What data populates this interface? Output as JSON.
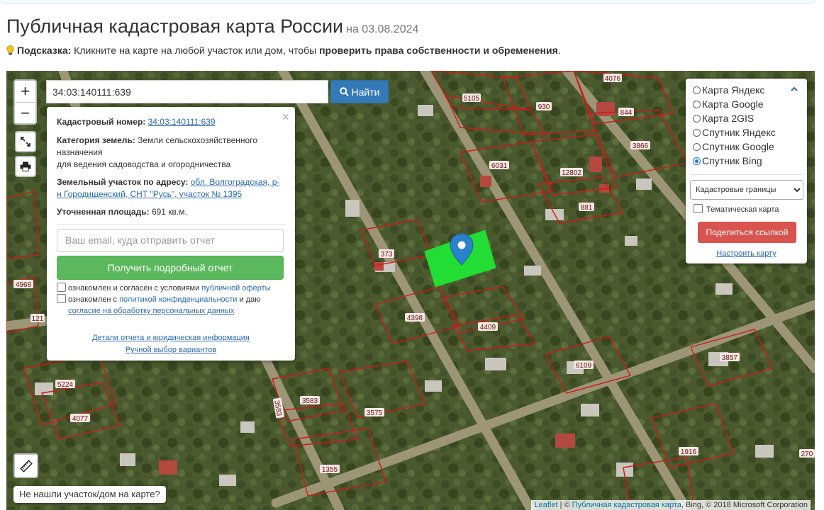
{
  "header": {
    "title": "Публичная кадастровая карта России",
    "date": "на 03.08.2024",
    "hint_label": "Подсказка:",
    "hint_text": " Кликните на карте на любой участок или дом, чтобы ",
    "hint_bold": "проверить права собственности и обременения",
    "hint_end": "."
  },
  "map": {
    "zoom_in": "+",
    "zoom_out": "−",
    "search_value": "34:03:140111:639",
    "search_button": "Найти",
    "parcel_numbers": [
      "4076",
      "5105",
      "930",
      "844",
      "3866",
      "6031",
      "12802",
      "881",
      "373",
      "4968",
      "121",
      "4398",
      "4409",
      "6109",
      "3857",
      "5224",
      "4077",
      "3583",
      "3575",
      "3583",
      "1916",
      "1355",
      "270"
    ],
    "selected_parcel_color": "#22dd33",
    "boundary_color": "#d01818",
    "not_found": "Не нашли участок/дом на карте?",
    "attribution": {
      "leaflet": "Leaflet",
      "sep": " | © ",
      "source": "Публичная кадастровая карта",
      "rest": ", Bing, © 2018 Microsoft Corporation"
    }
  },
  "popup": {
    "close": "×",
    "cad_label": "Кадастровый номер:",
    "cad_value": "34:03:140111:639",
    "cat_label": "Категория земель:",
    "cat_value_1": "Земли сельскохозяйственного",
    "cat_value_2": "назначения",
    "cat_value_3": "для ведения садоводства и огородничества",
    "addr_label": "Земельный участок по адресу:",
    "addr_value_1": "обл. Волгоградская, р-",
    "addr_value_2": "н Городищенский, СНТ \"Русь\", участок № 1395",
    "area_label": "Уточненная площадь:",
    "area_value": "691 кв.м.",
    "email_placeholder": "Ваш email, куда отправить отчет",
    "report_button": "Получить подробный отчет",
    "consent1_pre": "ознакомлен и согласен с условиями ",
    "consent1_link": "публичной оферты",
    "consent2_pre": "ознакомлен с ",
    "consent2_link": "политикой конфиденциальности",
    "consent2_mid": " и даю",
    "consent2_link2": "согласие на обработку персональных данных",
    "details_link": "Детали отчета и юридическая информация",
    "manual_link": "Ручной выбор вариантов"
  },
  "layers": {
    "options": [
      "Карта Яндекс",
      "Карта Google",
      "Карта 2GIS",
      "Спутник Яндекс",
      "Спутник Google",
      "Спутник Bing"
    ],
    "selected": "Спутник Bing",
    "overlay_select": "Кадастровые границы",
    "thematic": "Тематическая карта",
    "share_button": "Поделиться ссылкой",
    "configure": "Настроить карту"
  },
  "colors": {
    "primary": "#337ab7",
    "success": "#5cb85c",
    "danger": "#d9534f",
    "link": "#2a6ab0"
  }
}
